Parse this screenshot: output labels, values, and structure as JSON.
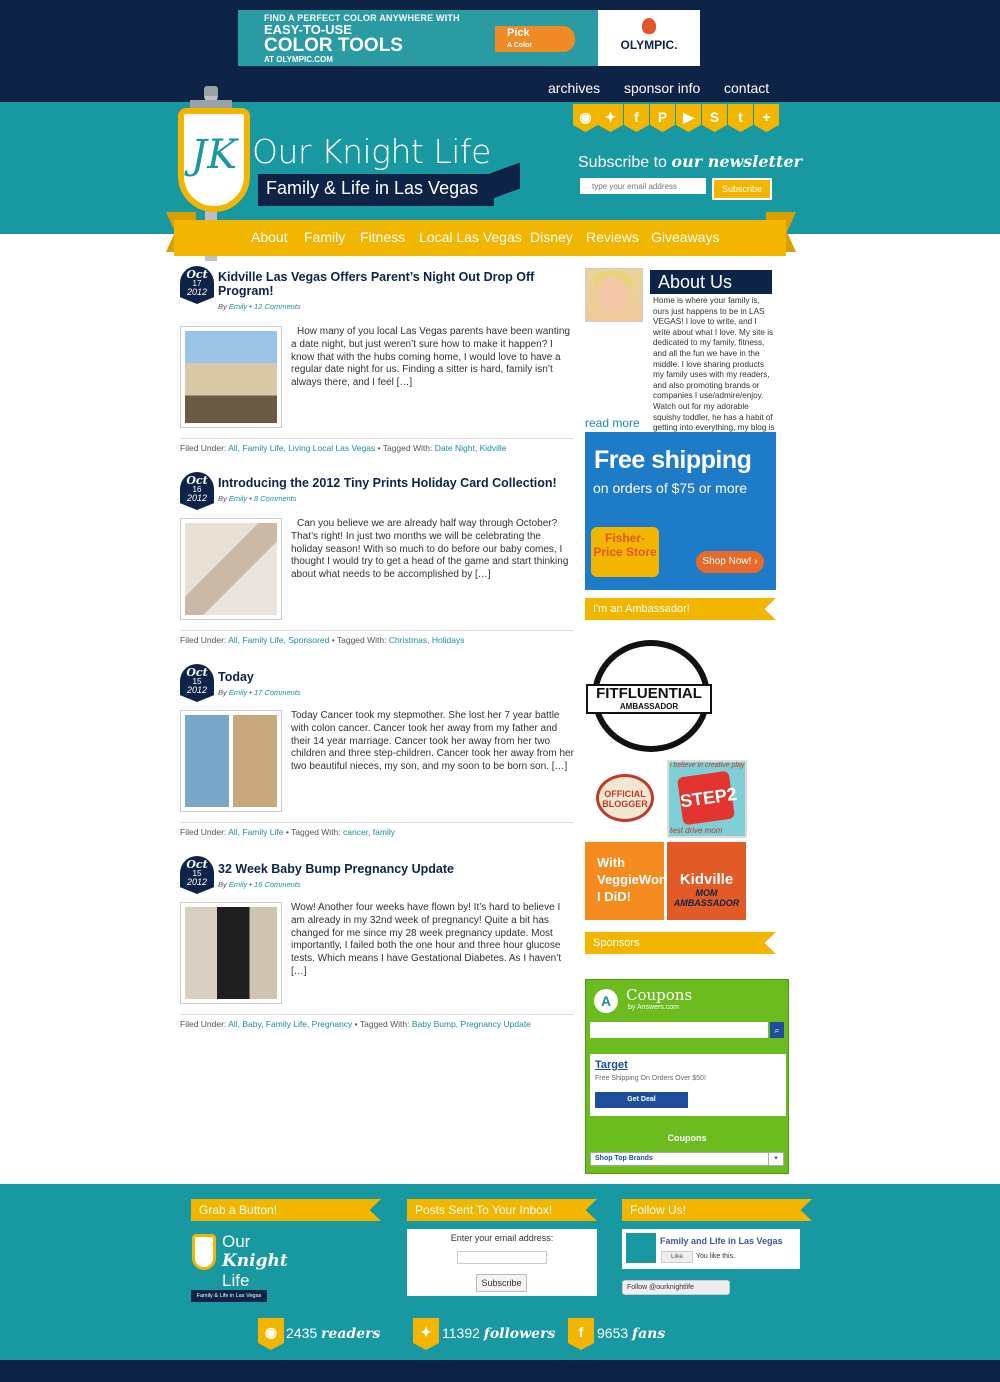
{
  "ad_top": {
    "line1": "FIND A PERFECT COLOR ANYWHERE WITH",
    "line2": "EASY-TO-USE",
    "line3": "COLOR TOOLS",
    "line4": "AT OLYMPIC.COM",
    "pick_label": "Pick",
    "pick_sub": "A Color",
    "brand": "OLYMPIC."
  },
  "top_nav": [
    "archives",
    "sponsor info",
    "contact"
  ],
  "logo": {
    "letters": "JK",
    "title": "Our Knight Life",
    "tagline": "Family & Life in Las Vegas"
  },
  "social_icons": [
    {
      "name": "rss-icon",
      "glyph": "◉"
    },
    {
      "name": "twitter-icon",
      "glyph": "✦"
    },
    {
      "name": "facebook-icon",
      "glyph": "f"
    },
    {
      "name": "pinterest-icon",
      "glyph": "P"
    },
    {
      "name": "youtube-icon",
      "glyph": "▶"
    },
    {
      "name": "stumbleupon-icon",
      "glyph": "S"
    },
    {
      "name": "tumblr-icon",
      "glyph": "t"
    },
    {
      "name": "plus-icon",
      "glyph": "+"
    }
  ],
  "newsletter": {
    "title_prefix": "Subscribe to",
    "title_emph": "our newsletter",
    "placeholder": "type your email address",
    "button": "Subscribe"
  },
  "main_nav": [
    "About",
    "Family",
    "Fitness",
    "Local Las Vegas",
    "Disney",
    "Reviews",
    "Giveaways"
  ],
  "posts": [
    {
      "month": "Oct",
      "day": "17",
      "year": "2012",
      "title": "Kidville Las Vegas Offers Parent’s Night Out Drop Off Program!",
      "by": "By",
      "author": "Emily",
      "comments": "12 Comments",
      "excerpt": "How many of you local Las Vegas parents have been wanting a date night, but just weren’t sure how to make it happen?  I know that with the hubs coming home, I would love to have a regular date night for us.  Finding a sitter is hard, family isn’t always there, and I feel […]",
      "filed_label": "Filed Under:",
      "filed": "All, Family Life, Living Local Las Vegas",
      "tagged_label": "Tagged With:",
      "tagged": "Date Night, Kidville"
    },
    {
      "month": "Oct",
      "day": "16",
      "year": "2012",
      "title": "Introducing the 2012 Tiny Prints Holiday Card Collection!",
      "by": "By",
      "author": "Emily",
      "comments": "8 Comments",
      "excerpt": "Can you believe we are already half way through October?  That’s right! In just two months we will be celebrating the holiday season!  With so much to do before our baby comes, I thought I would try to get a head of the game and start thinking about what needs to be accomplished by […]",
      "filed_label": "Filed Under:",
      "filed": "All, Family Life, Sponsored",
      "tagged_label": "Tagged With:",
      "tagged": "Christmas, Holidays"
    },
    {
      "month": "Oct",
      "day": "15",
      "year": "2012",
      "title": "Today",
      "by": "By",
      "author": "Emily",
      "comments": "17 Comments",
      "excerpt": "Today Cancer took my stepmother. She lost her 7 year battle with colon cancer. Cancer took her away from my father and their 14 year marriage. Cancer took her away from her two children and three step-children. Cancer took her away from her two beautiful nieces, my son, and my soon to be born son. […]",
      "filed_label": "Filed Under:",
      "filed": "All, Family Life",
      "tagged_label": "Tagged With:",
      "tagged": "cancer, family"
    },
    {
      "month": "Oct",
      "day": "15",
      "year": "2012",
      "title": "32 Week Baby Bump Pregnancy Update",
      "by": "By",
      "author": "Emily",
      "comments": "16 Comments",
      "excerpt": "Wow! Another four weeks have flown by! It’s hard to believe I am already in my 32nd week of pregnancy!  Quite a bit has changed for me since my 28 week pregnancy update.  Most importantly, I failed both the one hour and three hour glucose tests.  Which means I have Gestational Diabetes.  As I haven’t […]",
      "filed_label": "Filed Under:",
      "filed": "All, Baby, Family Life, Pregnancy",
      "tagged_label": "Tagged With:",
      "tagged": "Baby Bump, Pregnancy Update"
    }
  ],
  "sidebar": {
    "about_title": "About Us",
    "about_text": "Home is where your family is, ours just happens to be in LAS VEGAS! I love to write, and I write about what I love. My site is dedicated to my family, fitness, and all the fun we have in the middle. I love sharing products my family uses with my readers, and also promoting brands or companies I use/admire/enjoy. Watch out for my adorable squishy toddler, he has a habit of getting into everything, my blog is no exception! Emily - familyandlifeinlv(@)gmail.com",
    "read_more": "read more",
    "fp_ad": {
      "headline": "Free shipping",
      "sub": "on orders of $75 or more",
      "store": "Fisher-Price Store",
      "shop": "Shop Now! ›"
    },
    "ambassador_title": "I'm an Ambassador!",
    "fitfluential": {
      "name": "FITFLUENTIAL",
      "sub": "AMBASSADOR"
    },
    "blogger_badge": "OFFICIAL BLOGGER",
    "step2": {
      "top": "i believe in creative play",
      "logo": "STEP2",
      "bottom": "test drive mom"
    },
    "vw_badge": "With VeggieWorldz I DiD!",
    "kidville": {
      "name": "Kidville",
      "sub": "MOM AMBASSADOR"
    },
    "sponsors_title": "Sponsors",
    "coupons": {
      "logo": "A",
      "title": "Coupons",
      "by": "by Answers.com",
      "store": "Target",
      "desc": "Free Shipping On Orders Over $50!",
      "deal": "Get Deal",
      "footer": "Coupons",
      "select": "Shop Top Brands"
    }
  },
  "footer": {
    "grab_title": "Grab a Button!",
    "grab_logo": {
      "line1": "Our",
      "line2": "Knight",
      "line3": "Life",
      "banner": "Family & Life in Las Vegas"
    },
    "inbox_title": "Posts Sent To Your Inbox!",
    "inbox_label": "Enter your email address:",
    "inbox_submit": "Subscribe",
    "follow_title": "Follow Us!",
    "fb_name": "Family and Life in Las Vegas",
    "fb_like": "Like",
    "fb_likes_text": "You like this.",
    "tw_follow": "Follow @ourknightlife",
    "stats": [
      {
        "icon": "rss-icon",
        "glyph": "◉",
        "count": "2435",
        "unit": "readers"
      },
      {
        "icon": "twitter-icon",
        "glyph": "✦",
        "count": "11392",
        "unit": "followers"
      },
      {
        "icon": "facebook-icon",
        "glyph": "f",
        "count": "9653",
        "unit": "fans"
      }
    ]
  },
  "colors": {
    "navy": "#0e2447",
    "teal": "#1898a0",
    "gold": "#f2b600"
  }
}
